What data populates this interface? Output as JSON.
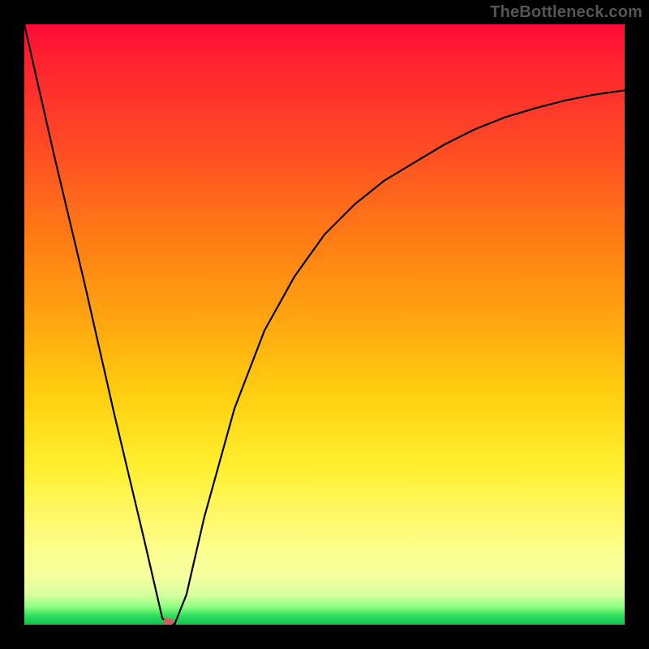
{
  "watermark": "TheBottleneck.com",
  "chart_data": {
    "type": "line",
    "title": "",
    "xlabel": "",
    "ylabel": "",
    "xlim": [
      0,
      100
    ],
    "ylim": [
      0,
      100
    ],
    "grid": false,
    "legend": false,
    "series": [
      {
        "name": "bottleneck-curve",
        "color": "#000000",
        "x": [
          0,
          5,
          10,
          15,
          20,
          23,
          25,
          27,
          30,
          35,
          40,
          45,
          50,
          55,
          60,
          65,
          70,
          75,
          80,
          85,
          90,
          95,
          100
        ],
        "y": [
          100,
          78,
          57,
          35,
          14,
          1,
          0,
          5,
          18,
          36,
          49,
          58,
          65,
          70,
          74,
          77,
          80,
          82.5,
          84.5,
          86,
          87.3,
          88.3,
          89
        ]
      }
    ],
    "annotations": [
      {
        "type": "marker",
        "shape": "ellipse",
        "x": 24,
        "y": 0.5,
        "color": "#d46060",
        "note": "minimum marker"
      }
    ],
    "background_gradient": {
      "direction": "vertical",
      "stops": [
        {
          "pos": 0.0,
          "color": "#ff0a3a"
        },
        {
          "pos": 0.35,
          "color": "#ff7a15"
        },
        {
          "pos": 0.62,
          "color": "#ffd010"
        },
        {
          "pos": 0.88,
          "color": "#fbff8f"
        },
        {
          "pos": 0.97,
          "color": "#90ff80"
        },
        {
          "pos": 1.0,
          "color": "#10c050"
        }
      ]
    }
  }
}
